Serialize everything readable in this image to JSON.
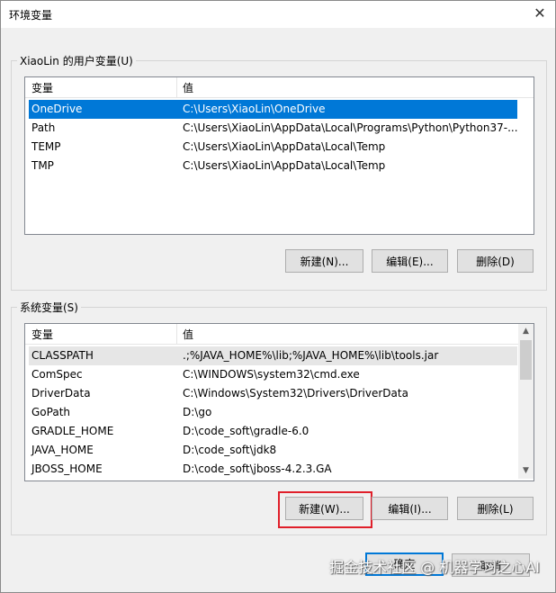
{
  "window": {
    "title": "环境变量",
    "close_icon": "close-icon"
  },
  "user_section": {
    "label": "XiaoLin 的用户变量(U)",
    "headers": {
      "variable": "变量",
      "value": "值"
    },
    "rows": [
      {
        "name": "OneDrive",
        "value": "C:\\Users\\XiaoLin\\OneDrive",
        "selected": true
      },
      {
        "name": "Path",
        "value": "C:\\Users\\XiaoLin\\AppData\\Local\\Programs\\Python\\Python37-..."
      },
      {
        "name": "TEMP",
        "value": "C:\\Users\\XiaoLin\\AppData\\Local\\Temp"
      },
      {
        "name": "TMP",
        "value": "C:\\Users\\XiaoLin\\AppData\\Local\\Temp"
      }
    ],
    "buttons": {
      "new": "新建(N)...",
      "edit": "编辑(E)...",
      "delete": "删除(D)"
    }
  },
  "system_section": {
    "label": "系统变量(S)",
    "headers": {
      "variable": "变量",
      "value": "值"
    },
    "rows": [
      {
        "name": "CLASSPATH",
        "value": ".;%JAVA_HOME%\\lib;%JAVA_HOME%\\lib\\tools.jar"
      },
      {
        "name": "ComSpec",
        "value": "C:\\WINDOWS\\system32\\cmd.exe"
      },
      {
        "name": "DriverData",
        "value": "C:\\Windows\\System32\\Drivers\\DriverData"
      },
      {
        "name": "GoPath",
        "value": "D:\\go"
      },
      {
        "name": "GRADLE_HOME",
        "value": "D:\\code_soft\\gradle-6.0"
      },
      {
        "name": "JAVA_HOME",
        "value": "D:\\code_soft\\jdk8"
      },
      {
        "name": "JBOSS_HOME",
        "value": "D:\\code_soft\\jboss-4.2.3.GA"
      }
    ],
    "buttons": {
      "new": "新建(W)...",
      "edit": "编辑(I)...",
      "delete": "删除(L)"
    }
  },
  "footer": {
    "ok": "确定",
    "cancel": "取消"
  },
  "watermark": "掘金技术社区 @ 机器学习之心AI",
  "colors": {
    "selection": "#0078d7",
    "highlight_box": "#e01f2a"
  }
}
